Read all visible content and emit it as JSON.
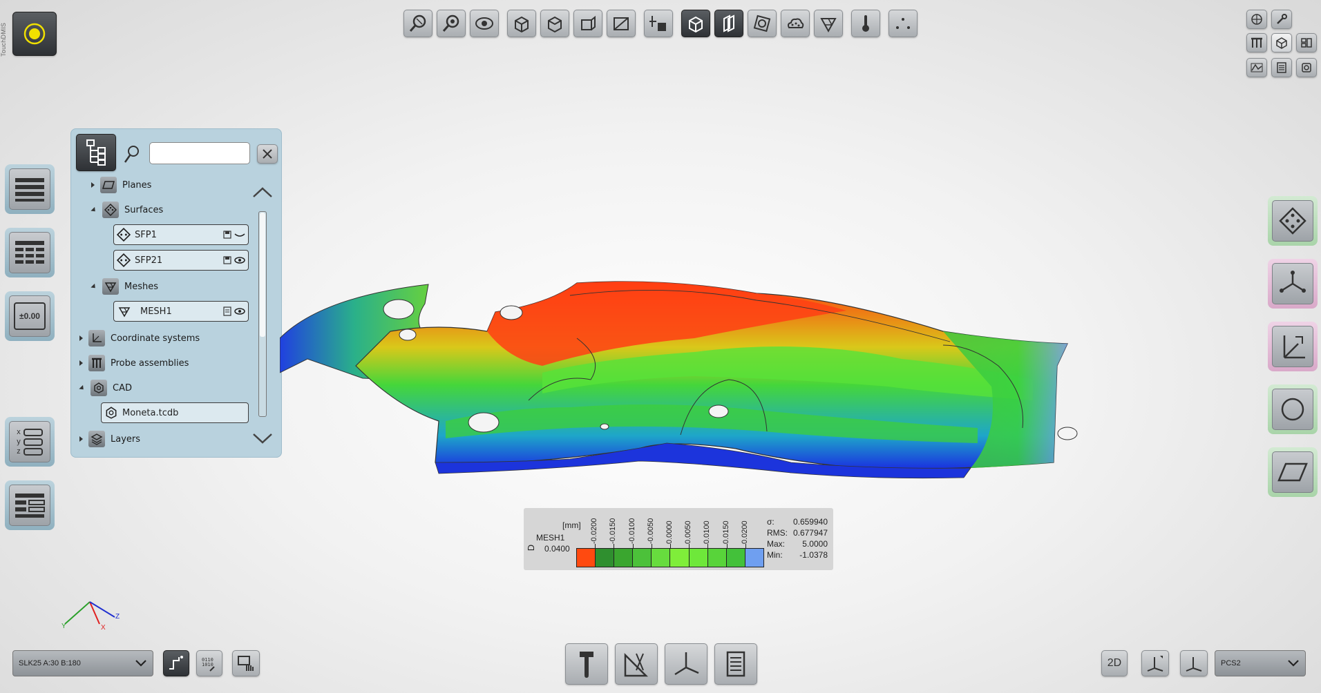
{
  "brand": {
    "vertical_text": "TouchDMIS"
  },
  "tree_panel": {
    "search": {
      "value": "",
      "placeholder": ""
    },
    "rows": {
      "planes": "Planes",
      "surfaces": "Surfaces",
      "sfp1": "SFP1",
      "sfp21": "SFP21",
      "meshes": "Meshes",
      "mesh1": "MESH1",
      "coordinate_systems": "Coordinate systems",
      "probe_assemblies": "Probe assemblies",
      "cad": "CAD",
      "cad_file": "Moneta.tcdb",
      "layers": "Layers"
    }
  },
  "left_side": {
    "tolerance_label": "±0.00",
    "xyz": [
      "x",
      "y",
      "z"
    ]
  },
  "legend": {
    "unit": "[mm]",
    "name": "MESH1",
    "value": "0.0400",
    "ticks": [
      "-0.0200",
      "-0.0150",
      "-0.0100",
      "-0.0050",
      "0.0000",
      "0.0050",
      "0.0100",
      "0.0150",
      "0.0200"
    ],
    "colors": [
      "#ff4a10",
      "#2f8f2f",
      "#3aa62f",
      "#4cc13a",
      "#67dc3e",
      "#7fee3a",
      "#6ee83a",
      "#58d43a",
      "#43c13a",
      "#6f9ff0"
    ],
    "stats": [
      {
        "label": "σ:",
        "value": "0.659940"
      },
      {
        "label": "RMS:",
        "value": "0.677947"
      },
      {
        "label": "Max:",
        "value": "5.0000"
      },
      {
        "label": "Min:",
        "value": "-1.0378"
      }
    ]
  },
  "axes": {
    "y": "Y",
    "x": "X",
    "z": "Z"
  },
  "bottom": {
    "probe_select": "SLK25 A:30 B:180",
    "view_2d": "2D",
    "coord_select": "PCS2"
  }
}
